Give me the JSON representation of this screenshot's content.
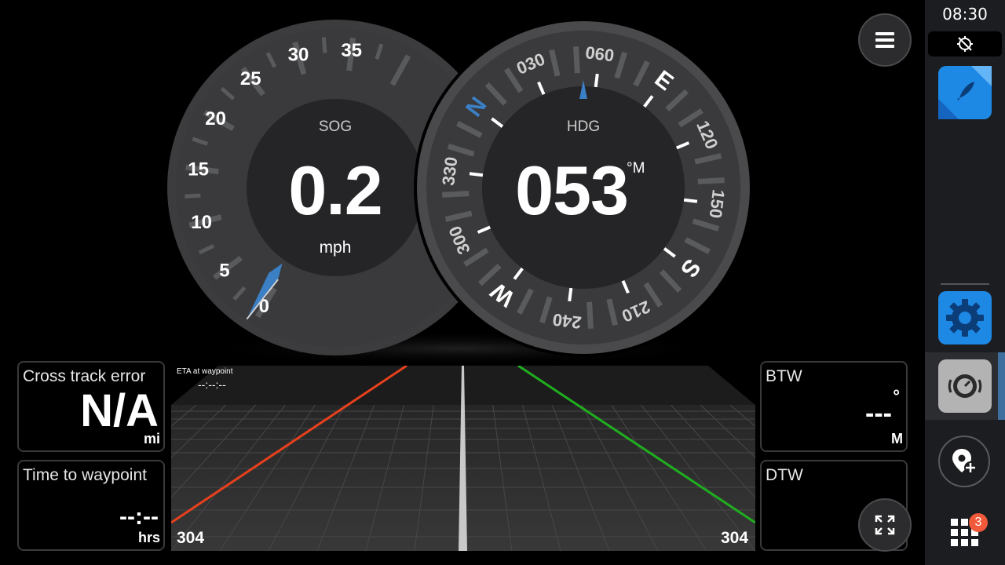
{
  "status": {
    "time": "08:30"
  },
  "sog_gauge": {
    "label": "SOG",
    "value": "0.2",
    "unit": "mph",
    "scale_labels": [
      "0",
      "5",
      "10",
      "15",
      "20",
      "25",
      "30",
      "35"
    ]
  },
  "hdg_gauge": {
    "label": "HDG",
    "value": "053",
    "unit": "°M",
    "heading_deg": 53,
    "compass_labels": [
      {
        "text": "N",
        "deg": 0
      },
      {
        "text": "030",
        "deg": 30
      },
      {
        "text": "060",
        "deg": 60
      },
      {
        "text": "E",
        "deg": 90
      },
      {
        "text": "120",
        "deg": 120
      },
      {
        "text": "150",
        "deg": 150
      },
      {
        "text": "S",
        "deg": 180
      },
      {
        "text": "210",
        "deg": 210
      },
      {
        "text": "240",
        "deg": 240
      },
      {
        "text": "W",
        "deg": 270
      },
      {
        "text": "300",
        "deg": 300
      },
      {
        "text": "330",
        "deg": 330
      }
    ]
  },
  "panels": {
    "cross_track": {
      "title": "Cross track error",
      "value": "N/A",
      "unit": "mi"
    },
    "time_to_wp": {
      "title": "Time to waypoint",
      "value": "--:--",
      "unit": "hrs"
    },
    "btw": {
      "title": "BTW",
      "value": "---",
      "degree": "°",
      "unit": "M"
    },
    "dtw": {
      "title": "DTW",
      "value": ""
    }
  },
  "highway": {
    "eta_label": "ETA at waypoint",
    "eta_value": "--:--:--",
    "left_value": "304",
    "right_value": "304"
  },
  "sidebar": {
    "notification_count": "3"
  },
  "colors": {
    "accent_blue": "#1e88e5",
    "needle_blue": "#3b7fc4",
    "port_red": "#e8401c",
    "starboard_green": "#1fae1f",
    "badge_orange": "#f05a3a"
  }
}
